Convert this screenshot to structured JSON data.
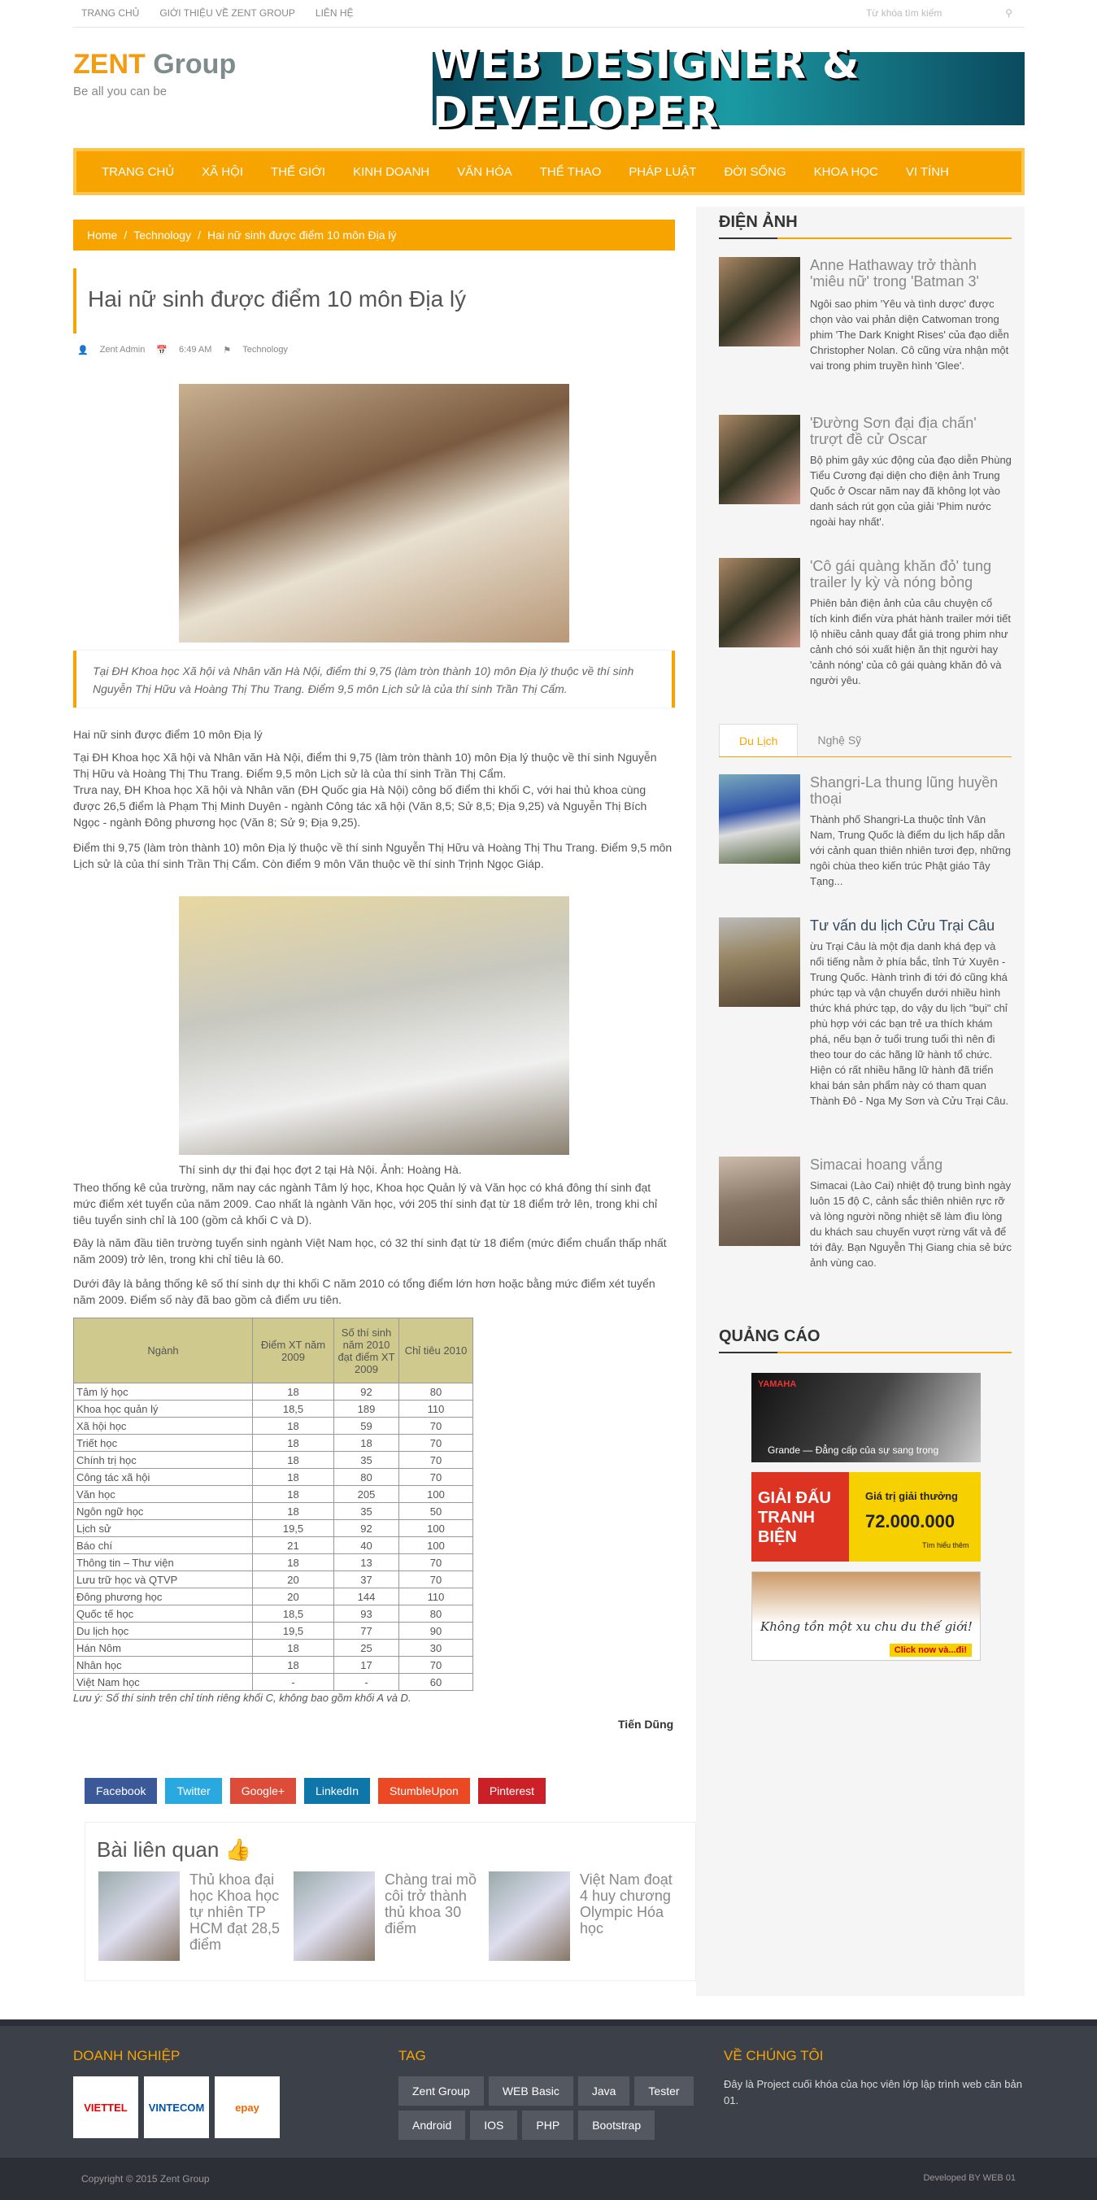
{
  "topbar": {
    "links": [
      "Trang chủ",
      "Giới thiệu về Zent Group",
      "Liên hệ"
    ],
    "search_placeholder": "Từ khóa tìm kiếm"
  },
  "logo": {
    "zent": "ZENT",
    "group": "Group",
    "tagline": "Be all you can be"
  },
  "banner": "WEB DESIGNER & DEVELOPER",
  "nav": [
    "Trang chủ",
    "Xã hội",
    "Thế giới",
    "Kinh doanh",
    "Văn hóa",
    "Thể thao",
    "Pháp luật",
    "Đời sống",
    "Khoa học",
    "Vi tính"
  ],
  "breadcrumb": [
    "Home",
    "/",
    "Technology",
    "/",
    "Hai nữ sinh được điểm 10 môn Địa lý"
  ],
  "article": {
    "title": "Hai nữ sinh được điểm 10 môn Địa lý",
    "author": "Zent Admin",
    "time": "6:49 AM",
    "category": "Technology",
    "quote": "Tại ĐH Khoa học Xã hội và Nhân văn Hà Nội, điểm thi 9,75 (làm tròn thành 10) môn Địa lý thuộc về thí sinh Nguyễn Thị Hữu và Hoàng Thị Thu Trang. Điểm 9,5 môn Lịch sử là của thí sinh Trần Thị Cẩm.",
    "p0": "Hai nữ sinh được điểm 10 môn Địa lý",
    "p1": "Tại ĐH Khoa học Xã hội và Nhân văn Hà Nội, điểm thi 9,75 (làm tròn thành 10) môn Địa lý thuộc về thí sinh Nguyễn Thị Hữu và Hoàng Thị Thu Trang. Điểm 9,5 môn Lịch sử là của thí sinh Trần Thị Cẩm.",
    "p2": "Trưa nay, ĐH Khoa học Xã hội và Nhân văn (ĐH Quốc gia Hà Nội) công bố điểm thi khối C, với hai thủ khoa cùng được 26,5 điểm là Phạm Thị Minh Duyên - ngành Công tác xã hội (Văn 8,5; Sử 8,5; Địa 9,25) và Nguyễn Thị Bích Ngọc - ngành Đông phương học (Văn 8; Sử 9; Địa 9,25).",
    "p3": "Điểm thi 9,75 (làm tròn thành 10) môn Địa lý thuộc về thí sinh Nguyễn Thị Hữu và Hoàng Thị Thu Trang. Điểm 9,5 môn Lịch sử là của thí sinh Trần Thị Cẩm. Còn điểm 9 môn Văn thuộc về thí sinh Trịnh Ngọc Giáp.",
    "caption": "Thí sinh dự thi đại học đợt 2 tại Hà Nội. Ảnh: Hoàng Hà.",
    "p4": "Theo thống kê của trường, năm nay các ngành Tâm lý học, Khoa học Quản lý và Văn học có khá đông thí sinh đạt mức điểm xét tuyển của năm 2009. Cao nhất là ngành Văn học, với 205 thí sinh đạt từ 18 điểm trở lên, trong khi chỉ tiêu tuyển sinh chỉ là 100 (gồm cả khối C và D).",
    "p5": "Đây là năm đầu tiên trường tuyển sinh ngành Việt Nam học, có 32 thí sinh đạt từ 18 điểm (mức điểm chuẩn thấp nhất năm 2009) trở lên, trong khi chỉ tiêu là 60.",
    "p6": "Dưới đây là bảng thống kê số thí sinh dự thi khối C năm 2010 có tổng điểm lớn hơn hoặc bằng mức điểm xét tuyển năm 2009. Điểm số này đã bao gồm cả điểm ưu tiên.",
    "table_head": [
      "Ngành",
      "Điểm XT năm 2009",
      "Số thí sinh năm 2010 đạt điểm XT 2009",
      "Chỉ tiêu 2010"
    ],
    "table_rows": [
      [
        "Tâm lý học",
        "18",
        "92",
        "80"
      ],
      [
        "Khoa học quản lý",
        "18,5",
        "189",
        "110"
      ],
      [
        "Xã hội học",
        "18",
        "59",
        "70"
      ],
      [
        "Triết học",
        "18",
        "18",
        "70"
      ],
      [
        "Chính trị học",
        "18",
        "35",
        "70"
      ],
      [
        "Công tác xã hội",
        "18",
        "80",
        "70"
      ],
      [
        "Văn học",
        "18",
        "205",
        "100"
      ],
      [
        "Ngôn ngữ học",
        "18",
        "35",
        "50"
      ],
      [
        "Lịch sử",
        "19,5",
        "92",
        "100"
      ],
      [
        "Báo chí",
        "21",
        "40",
        "100"
      ],
      [
        "Thông tin – Thư viện",
        "18",
        "13",
        "70"
      ],
      [
        "Lưu trữ học và QTVP",
        "20",
        "37",
        "70"
      ],
      [
        "Đông phương học",
        "20",
        "144",
        "110"
      ],
      [
        "Quốc tế học",
        "18,5",
        "93",
        "80"
      ],
      [
        "Du lịch học",
        "19,5",
        "77",
        "90"
      ],
      [
        "Hán Nôm",
        "18",
        "25",
        "30"
      ],
      [
        "Nhân học",
        "18",
        "17",
        "70"
      ],
      [
        "Việt Nam học",
        "-",
        "-",
        "60"
      ]
    ],
    "note": "Lưu ý: Số thí sinh trên chỉ tính riêng khối C, không bao gồm khối A và D.",
    "signature": "Tiến Dũng"
  },
  "share": [
    {
      "label": "Facebook",
      "color": "#3b5998"
    },
    {
      "label": "Twitter",
      "color": "#2aa9e0"
    },
    {
      "label": "Google+",
      "color": "#dd4b39"
    },
    {
      "label": "LinkedIn",
      "color": "#0e76a8"
    },
    {
      "label": "StumbleUpon",
      "color": "#eb4924"
    },
    {
      "label": "Pinterest",
      "color": "#cb2027"
    }
  ],
  "related": {
    "heading": "Bài liên quan",
    "items": [
      "Thủ khoa đại học Khoa học tự nhiên TP HCM đạt 28,5 điểm",
      "Chàng trai mồ côi trở thành thủ khoa 30 điểm",
      "Việt Nam đoạt 4 huy chương Olympic Hóa học"
    ]
  },
  "sidebar": {
    "cinema_title": "ĐIỆN ẢNH",
    "cinema": [
      {
        "title": "Anne Hathaway trở thành 'miêu nữ' trong 'Batman 3'",
        "desc": "Ngôi sao phim 'Yêu và tình dược' được chọn vào vai phản diện Catwoman trong phim 'The Dark Knight Rises' của đạo diễn Christopher Nolan. Cô cũng vừa nhận một vai trong phim truyền hình 'Glee'."
      },
      {
        "title": "'Đường Sơn đại địa chấn' trượt đề cử Oscar",
        "desc": "Bộ phim gây xúc động của đạo diễn Phùng Tiểu Cương đại diện cho điện ảnh Trung Quốc ở Oscar năm nay đã không lọt vào danh sách rút gọn của giải 'Phim nước ngoài hay nhất'."
      },
      {
        "title": "'Cô gái quàng khăn đỏ' tung trailer ly kỳ và nóng bỏng",
        "desc": "Phiên bản điện ảnh của câu chuyện cổ tích kinh điển vừa phát hành trailer mới tiết lộ nhiều cảnh quay đắt giá trong phim như cảnh chó sói xuất hiện ăn thịt người hay 'cảnh nóng' của cô gái quàng khăn đỏ và người yêu."
      }
    ],
    "tabs": [
      "Du Lịch",
      "Nghệ Sỹ"
    ],
    "travel": [
      {
        "title": "Shangri-La thung lũng huyền thoại",
        "desc": "Thành phố Shangri-La thuộc tỉnh Vân Nam, Trung Quốc là điểm du lịch hấp dẫn với cảnh quan thiên nhiên tươi đẹp, những ngôi chùa theo kiến trúc Phật giáo Tây Tạng..."
      },
      {
        "title": "Tư vấn du lịch Cửu Trại Câu",
        "desc": "ừu Trại Câu là một địa danh khá đẹp và nổi tiếng nằm ở phía bắc, tỉnh Tứ Xuyên - Trung Quốc. Hành trình đi tới đó cũng khá phức tạp và vận chuyển dưới nhiều hình thức khá phức tạp, do vậy du lịch \"bụi\" chỉ phù hợp với các bạn trẻ ưa thích khám phá, nếu bạn ở tuổi trung tuổi thì nên đi theo tour do các hãng lữ hành tổ chức. Hiện có rất nhiều hãng lữ hành đã triển khai bán sản phẩm này có tham quan Thành Đô - Nga My Sơn và Cửu Trại Câu."
      },
      {
        "title": "Simacai hoang vắng",
        "desc": "Simacai (Lào Cai) nhiệt độ trung bình ngày luôn 15 độ C, cảnh sắc thiên nhiên rực rỡ và lòng người nồng nhiệt sẽ làm đìu lòng du khách sau chuyến vượt rừng vất vả để tới đây. Bạn Nguyễn Thị Giang chia sẻ bức ảnh vùng cao."
      }
    ],
    "ads_title": "QUẢNG CÁO",
    "ads": [
      {
        "text": "Grande — Đẳng cấp của sự sang trọng",
        "brand": "YAMAHA"
      },
      {
        "text": "GIẢI ĐẤU TRANH BIỆN",
        "prize": "Giá trị giải thưởng",
        "amount": "72.000.000",
        "cta": "Tìm hiểu thêm"
      },
      {
        "text": "Không tồn một xu chu du thế giới!",
        "cta": "Click now và...đi!"
      }
    ]
  },
  "footer": {
    "biz_title": "DOANH NGHIỆP",
    "logos": [
      "VIETTEL",
      "VINTECOM",
      "epay"
    ],
    "tag_title": "TAG",
    "tags": [
      "Zent Group",
      "WEB Basic",
      "Java",
      "Tester",
      "Android",
      "IOS",
      "PHP",
      "Bootstrap"
    ],
    "about_title": "VỀ CHÚNG TÔI",
    "about": "Đây là Project cuối khóa của học viên lớp lập trình web căn bản 01.",
    "copyright": "Copyright © 2015 Zent Group",
    "developed": "Developed BY WEB 01"
  }
}
